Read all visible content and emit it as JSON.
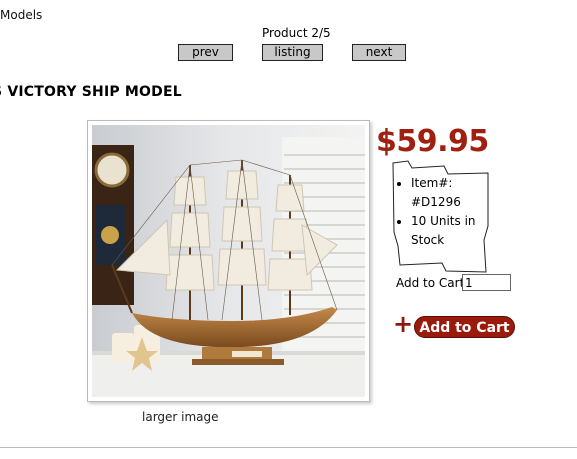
{
  "breadcrumb": "Models",
  "pager": {
    "label": "Product 2/5",
    "prev": "prev",
    "listing": "listing",
    "next": "next"
  },
  "product": {
    "title": "S VICTORY SHIP MODEL",
    "price": "$59.95",
    "details": [
      "Item#: #D1296",
      "10 Units in Stock"
    ],
    "larger_image": "larger image"
  },
  "cart": {
    "label": "Add to Cart:",
    "quantity": "1",
    "button": "Add to Cart",
    "plus_icon": "plus-icon"
  },
  "colors": {
    "price": "#a02010",
    "button": "#9a1a0c",
    "nav_button": "#c8c8c8"
  }
}
